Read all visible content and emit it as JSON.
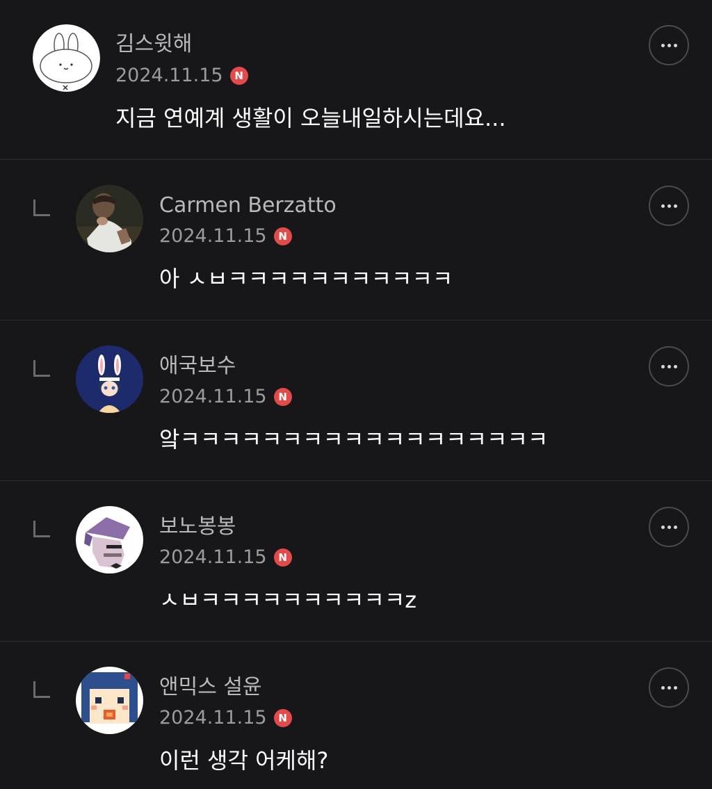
{
  "comments": [
    {
      "author": "김스윗해",
      "date": "2024.11.15",
      "badge": "N",
      "text": "지금 연예계 생활이 오늘내일하시는데요...",
      "avatar_icon": "bunny-avatar-icon",
      "is_reply": false
    },
    {
      "author": "Carmen Berzatto",
      "date": "2024.11.15",
      "badge": "N",
      "text": "아 ㅅㅂㅋㅋㅋㅋㅋㅋㅋㅋㅋㅋㅋ",
      "avatar_icon": "photo-avatar-icon",
      "is_reply": true
    },
    {
      "author": "애국보수",
      "date": "2024.11.15",
      "badge": "N",
      "text": "앜ㅋㅋㅋㅋㅋㅋㅋㅋㅋㅋㅋㅋㅋㅋㅋㅋㅋㅋ",
      "avatar_icon": "bunny-girl-avatar-icon",
      "is_reply": true
    },
    {
      "author": "보노봉봉",
      "date": "2024.11.15",
      "badge": "N",
      "text": "ㅅㅂㅋㅋㅋㅋㅋㅋㅋㅋㅋㅋz",
      "avatar_icon": "pixel-man-avatar-icon",
      "is_reply": true
    },
    {
      "author": "앤믹스 설윤",
      "date": "2024.11.15",
      "badge": "N",
      "text": "이런 생각 어케해?",
      "avatar_icon": "pixel-girl-avatar-icon",
      "is_reply": true
    }
  ],
  "colors": {
    "background": "#17171a",
    "badge": "#e34b4b",
    "divider": "#2e2e32"
  },
  "icons": {
    "more": "more-options-icon",
    "reply": "reply-arrow-icon"
  }
}
